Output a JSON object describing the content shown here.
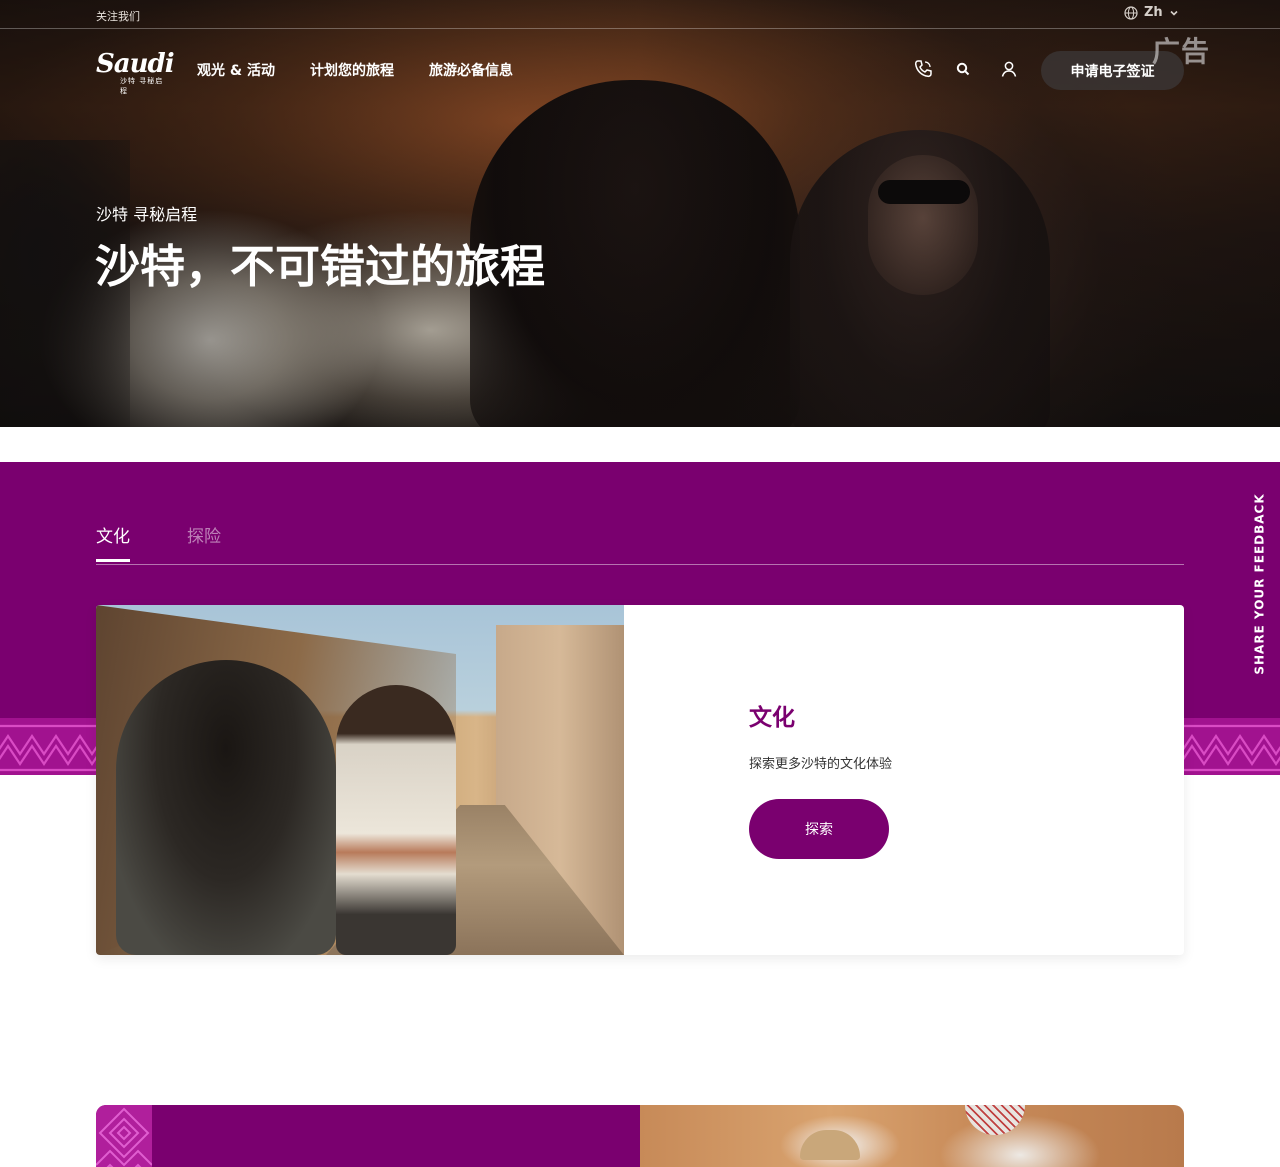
{
  "topbar": {
    "follow_label": "关注我们",
    "language": "Zh"
  },
  "logo": {
    "word": "Saudi",
    "subtitle": "沙特 寻秘启程"
  },
  "nav": {
    "items": [
      "观光 & 活动",
      "计划您的旅程",
      "旅游必备信息"
    ]
  },
  "header": {
    "visa_button": "申请电子签证",
    "ad_label": "广告"
  },
  "hero": {
    "kicker": "沙特 寻秘启程",
    "title": "沙特，不可错过的旅程"
  },
  "tabs": [
    {
      "label": "文化",
      "active": true
    },
    {
      "label": "探险",
      "active": false
    }
  ],
  "feedback": {
    "label": "SHARE YOUR FEEDBACK"
  },
  "card": {
    "title": "文化",
    "description": "探索更多沙特的文化体验",
    "button": "探索"
  },
  "colors": {
    "brand_purple": "#7a006f",
    "pattern_pink": "#c2008a",
    "white": "#ffffff"
  },
  "icons": {
    "globe": "globe-icon",
    "chevron": "chevron-down-icon",
    "phone": "phone-icon",
    "search": "search-icon",
    "user": "user-icon"
  }
}
